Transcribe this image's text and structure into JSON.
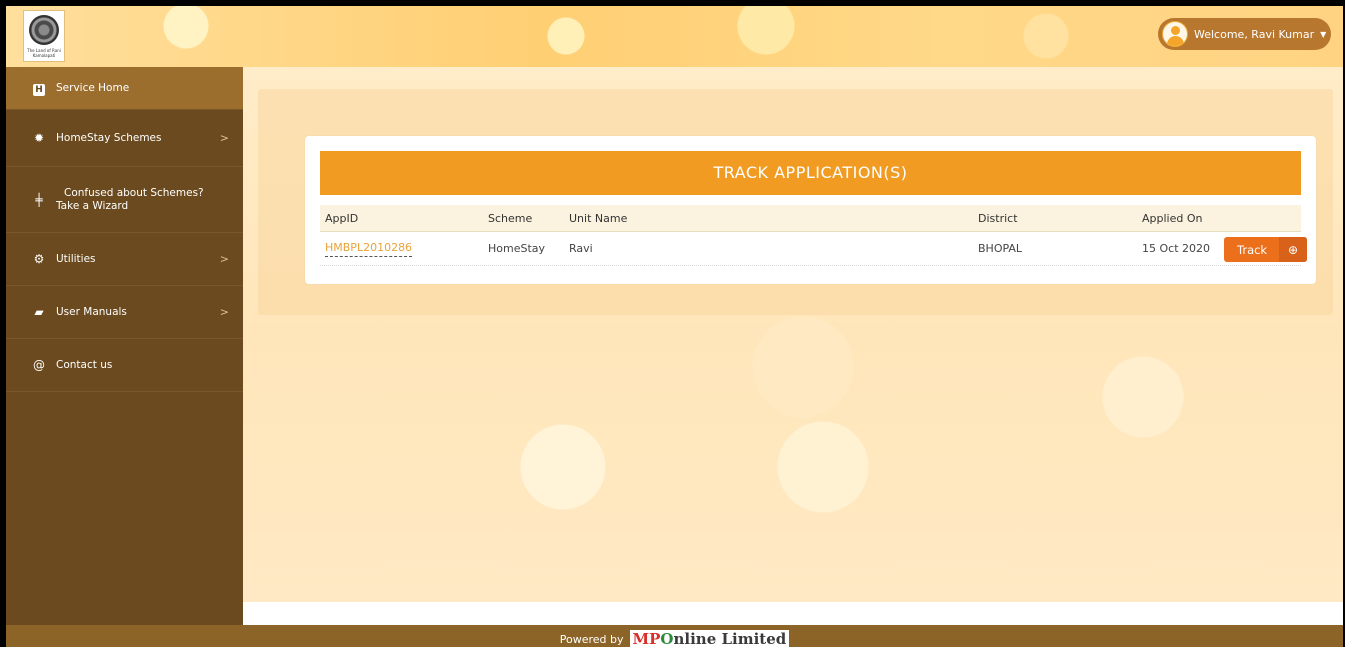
{
  "header": {
    "logo_text": "The Land of Rani Kamalapati",
    "welcome_text": "Welcome, Ravi Kumar",
    "caret_icon": "caret-down-icon"
  },
  "sidebar": {
    "items": [
      {
        "label": "Service Home",
        "icon": "h-square-icon",
        "active": true
      },
      {
        "label": "HomeStay Schemes",
        "icon": "gear-icon",
        "has_chevron": true
      },
      {
        "label_line1": "Confused about Schemes?",
        "label_line2": "Take a Wizard",
        "icon": "signpost-icon"
      },
      {
        "label": "Utilities",
        "icon": "cogs-icon",
        "has_chevron": true
      },
      {
        "label": "User Manuals",
        "icon": "book-icon",
        "has_chevron": true
      },
      {
        "label": "Contact us",
        "icon": "at-icon"
      }
    ]
  },
  "main": {
    "title": "TRACK APPLICATION(S)",
    "table": {
      "headers": [
        "AppID",
        "Scheme",
        "Unit Name",
        "District",
        "Applied On"
      ],
      "rows": [
        {
          "appid": "HMBPL2010286",
          "scheme": "HomeStay",
          "unit": "Ravi",
          "district": "BHOPAL",
          "applied_on": "15 Oct 2020",
          "action": "Track"
        }
      ]
    }
  },
  "footer": {
    "powered_by": "Powered by",
    "brand_mp": "MP",
    "brand_o": "O",
    "brand_rest": "nline Limited"
  },
  "colors": {
    "accent": "#f29b22",
    "sidebar": "#6a4a1e",
    "track_button": "#ec6f1c"
  }
}
